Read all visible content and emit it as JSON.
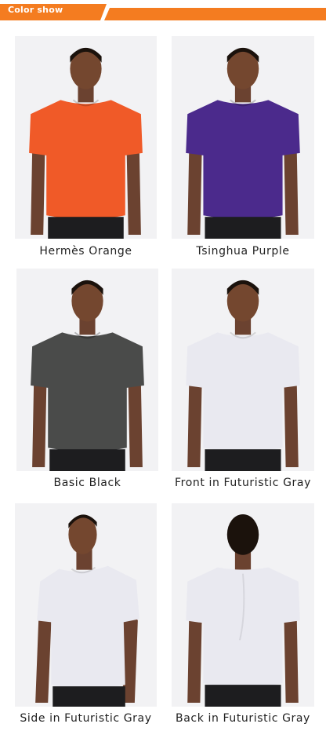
{
  "header": {
    "title": "Color show",
    "accent": "#f47c20"
  },
  "products": [
    {
      "label": "Hermès Orange",
      "shirt_color": "#f05a28",
      "view": "front"
    },
    {
      "label": "Tsinghua Purple",
      "shirt_color": "#4b2a8c",
      "view": "front"
    },
    {
      "label": "Basic Black",
      "shirt_color": "#4a4b4a",
      "view": "front"
    },
    {
      "label": "Front in Futuristic Gray",
      "shirt_color": "#e9e9f0",
      "view": "front"
    },
    {
      "label": "Side in Futuristic Gray",
      "shirt_color": "#e9e9f0",
      "view": "side"
    },
    {
      "label": "Back in Futuristic Gray",
      "shirt_color": "#e9e9f0",
      "view": "back"
    }
  ]
}
